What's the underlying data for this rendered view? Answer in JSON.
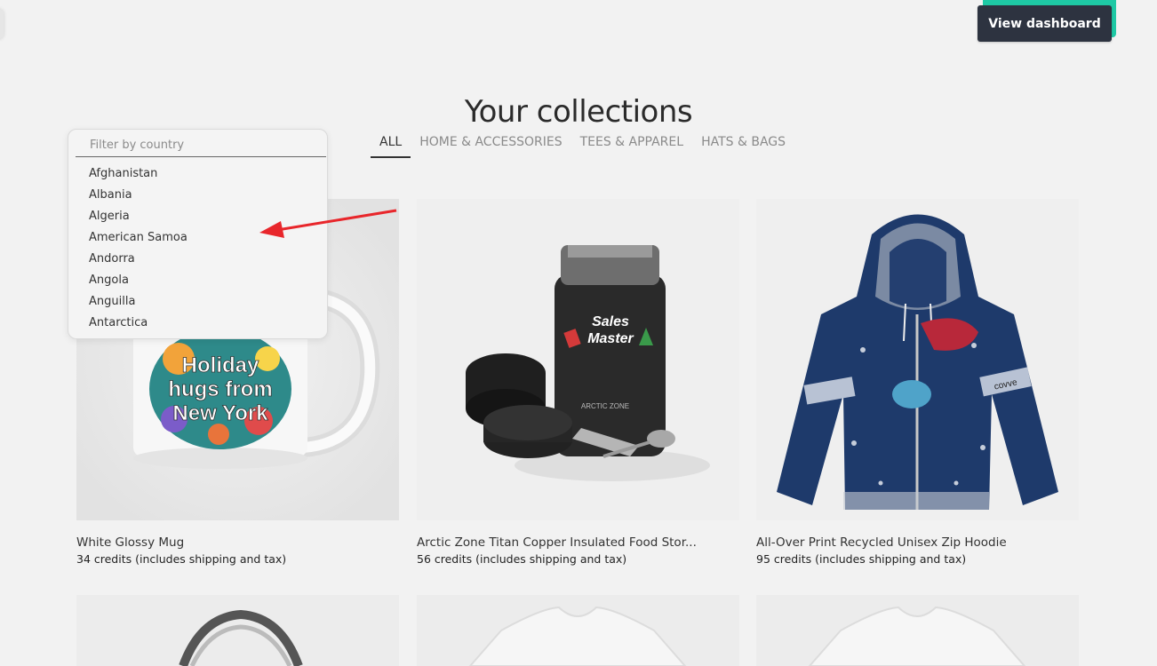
{
  "header": {
    "view_dashboard_label": "View dashboard"
  },
  "page_title": "Your collections",
  "tabs": [
    {
      "label": "ALL",
      "active": true
    },
    {
      "label": "HOME & ACCESSORIES",
      "active": false
    },
    {
      "label": "TEES & APPAREL",
      "active": false
    },
    {
      "label": "HATS & BAGS",
      "active": false
    }
  ],
  "country_filter": {
    "placeholder": "Filter by country",
    "options": [
      "Afghanistan",
      "Albania",
      "Algeria",
      "American Samoa",
      "Andorra",
      "Angola",
      "Anguilla",
      "Antarctica"
    ]
  },
  "products": [
    {
      "name": "White Glossy Mug",
      "price": "34 credits (includes shipping and tax)",
      "mug_text": [
        "Holiday",
        "hugs from",
        "New York"
      ]
    },
    {
      "name": "Arctic Zone Titan Copper Insulated Food Stor...",
      "price": "56 credits (includes shipping and tax)",
      "jar_text": [
        "Sales",
        "Master"
      ],
      "brand": "ARCTIC ZONE"
    },
    {
      "name": "All-Over Print Recycled Unisex Zip Hoodie",
      "price": "95 credits (includes shipping and tax)",
      "sleeve_brand": "covve"
    }
  ],
  "colors": {
    "accent": "#1ec9a5",
    "button_dark": "#2d3340",
    "annotation_arrow": "#e8262b",
    "hoodie": "#1e3a6b"
  }
}
